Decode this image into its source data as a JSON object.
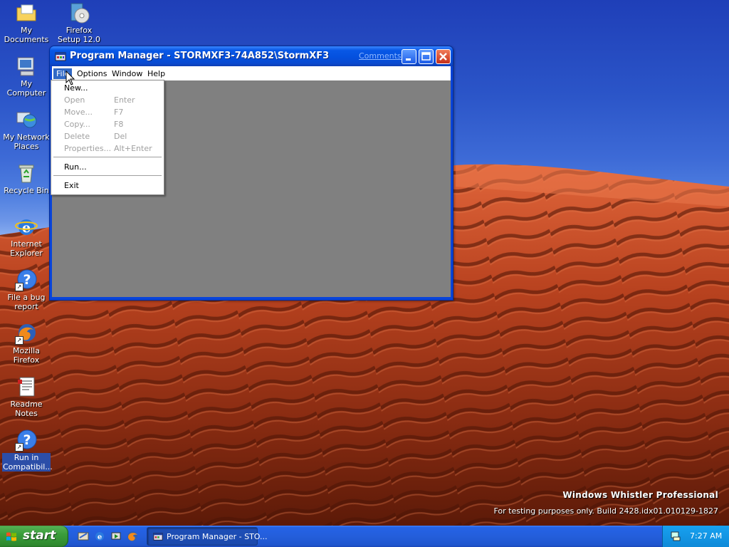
{
  "desktop": {
    "icons": [
      {
        "label": "My Documents"
      },
      {
        "label": "Firefox Setup 12.0"
      },
      {
        "label": "My Computer"
      },
      {
        "label": "My Network Places"
      },
      {
        "label": "Recycle Bin"
      },
      {
        "label": "Internet Explorer"
      },
      {
        "label": "File a bug report"
      },
      {
        "label": "Mozilla Firefox"
      },
      {
        "label": "Readme Notes"
      },
      {
        "label": "Run in Compatibil..."
      }
    ]
  },
  "window": {
    "title": "Program Manager - STORMXF3-74A852\\StormXF3",
    "comments_link": "Comments?",
    "menus": [
      "File",
      "Options",
      "Window",
      "Help"
    ]
  },
  "file_menu": {
    "items": [
      {
        "label": "New...",
        "shortcut": ""
      },
      {
        "label": "Open",
        "shortcut": "Enter"
      },
      {
        "label": "Move...",
        "shortcut": "F7"
      },
      {
        "label": "Copy...",
        "shortcut": "F8"
      },
      {
        "label": "Delete",
        "shortcut": "Del"
      },
      {
        "label": "Properties...",
        "shortcut": "Alt+Enter"
      },
      {
        "label": "Run...",
        "shortcut": ""
      },
      {
        "label": "Exit",
        "shortcut": ""
      }
    ]
  },
  "watermark": {
    "title": "Windows Whistler Professional",
    "build": "For testing purposes only. Build 2428.idx01.010129-1827"
  },
  "taskbar": {
    "start_label": "start",
    "task_button": "Program Manager - STO...",
    "clock": "7:27 AM"
  },
  "colors": {
    "titlebar": "#0450de",
    "menu_highlight": "#3169c6",
    "client_gray": "#808080",
    "start_green": "#3a9d3a",
    "taskbar_blue": "#245edb"
  }
}
